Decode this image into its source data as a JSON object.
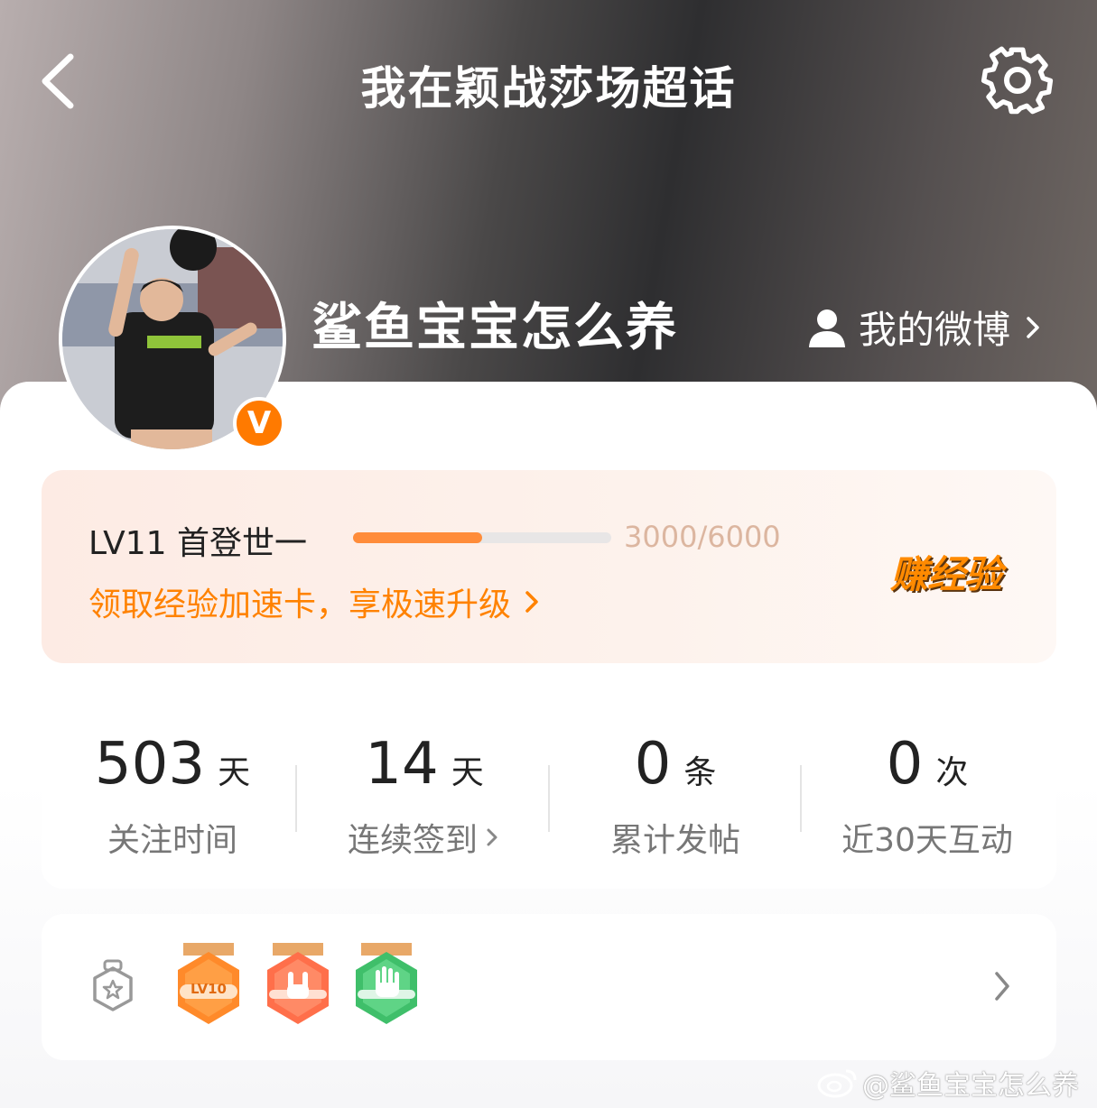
{
  "header": {
    "title": "我在颖战莎场超话",
    "back_icon": "chevron-left-icon",
    "settings_icon": "gear-icon"
  },
  "profile": {
    "username": "鲨鱼宝宝怎么养",
    "verified_badge": "V",
    "my_weibo_label": "我的微博"
  },
  "level": {
    "label": "LV11 首登世一",
    "progress_text": "3000/6000",
    "progress_fraction": 0.5,
    "promo": "领取经验加速卡，享极速升级",
    "earn_button": "赚经验",
    "accent_color": "#ff8200"
  },
  "stats": [
    {
      "value": "503",
      "unit": "天",
      "label": "关注时间",
      "has_arrow": false
    },
    {
      "value": "14",
      "unit": "天",
      "label": "连续签到",
      "has_arrow": true
    },
    {
      "value": "0",
      "unit": "条",
      "label": "累计发帖",
      "has_arrow": false
    },
    {
      "value": "0",
      "unit": "次",
      "label": "近30天互动",
      "has_arrow": false
    }
  ],
  "badges": [
    {
      "name": "lv10-badge",
      "text": "LV10",
      "color": "#ff8a2a"
    },
    {
      "name": "rock-hand-badge",
      "color": "#ff6f4a"
    },
    {
      "name": "palm-badge",
      "color": "#3fbf6a"
    }
  ],
  "watermark": "@鲨鱼宝宝怎么养"
}
